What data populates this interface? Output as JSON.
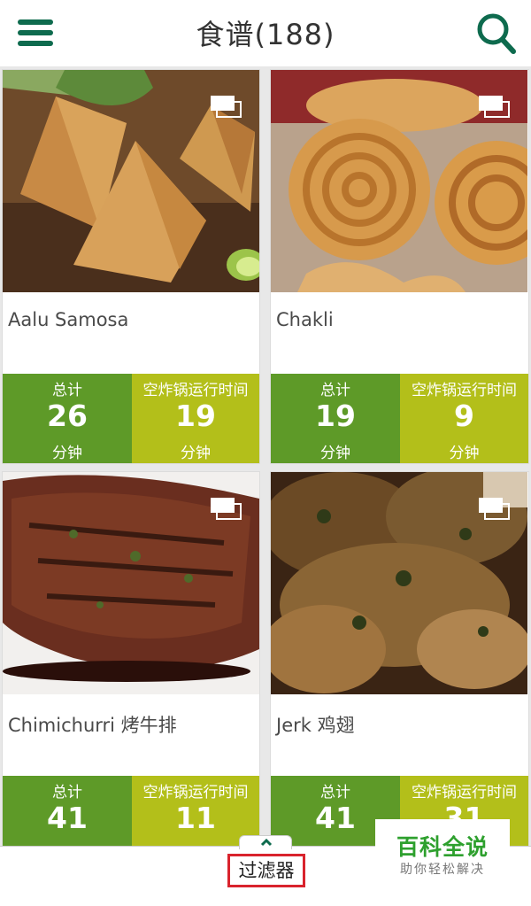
{
  "header": {
    "title": "食谱(188)",
    "menu_icon": "hamburger-menu-icon",
    "search_icon": "search-icon"
  },
  "colors": {
    "brand_green": "#0e6b4e",
    "total_bg": "#5e9a28",
    "airfryer_bg": "#b3bf1a",
    "filter_border": "#d9232d"
  },
  "recipes": [
    {
      "name": "Aalu Samosa",
      "total_label": "总计",
      "total_value": "26",
      "total_unit": "分钟",
      "air_label": "空炸锅运行时间",
      "air_value": "19",
      "air_unit": "分钟"
    },
    {
      "name": "Chakli",
      "total_label": "总计",
      "total_value": "19",
      "total_unit": "分钟",
      "air_label": "空炸锅运行时间",
      "air_value": "9",
      "air_unit": "分钟"
    },
    {
      "name": "Chimichurri 烤牛排",
      "total_label": "总计",
      "total_value": "41",
      "total_unit": "",
      "air_label": "空炸锅运行时间",
      "air_value": "11",
      "air_unit": ""
    },
    {
      "name": "Jerk 鸡翅",
      "total_label": "总计",
      "total_value": "41",
      "total_unit": "",
      "air_label": "空炸锅运行时间",
      "air_value": "31",
      "air_unit": ""
    }
  ],
  "footer": {
    "filter_label": "过滤器",
    "chevron_icon": "chevron-up-icon"
  },
  "watermark": {
    "title": "百科全说",
    "subtitle": "助你轻松解决"
  }
}
